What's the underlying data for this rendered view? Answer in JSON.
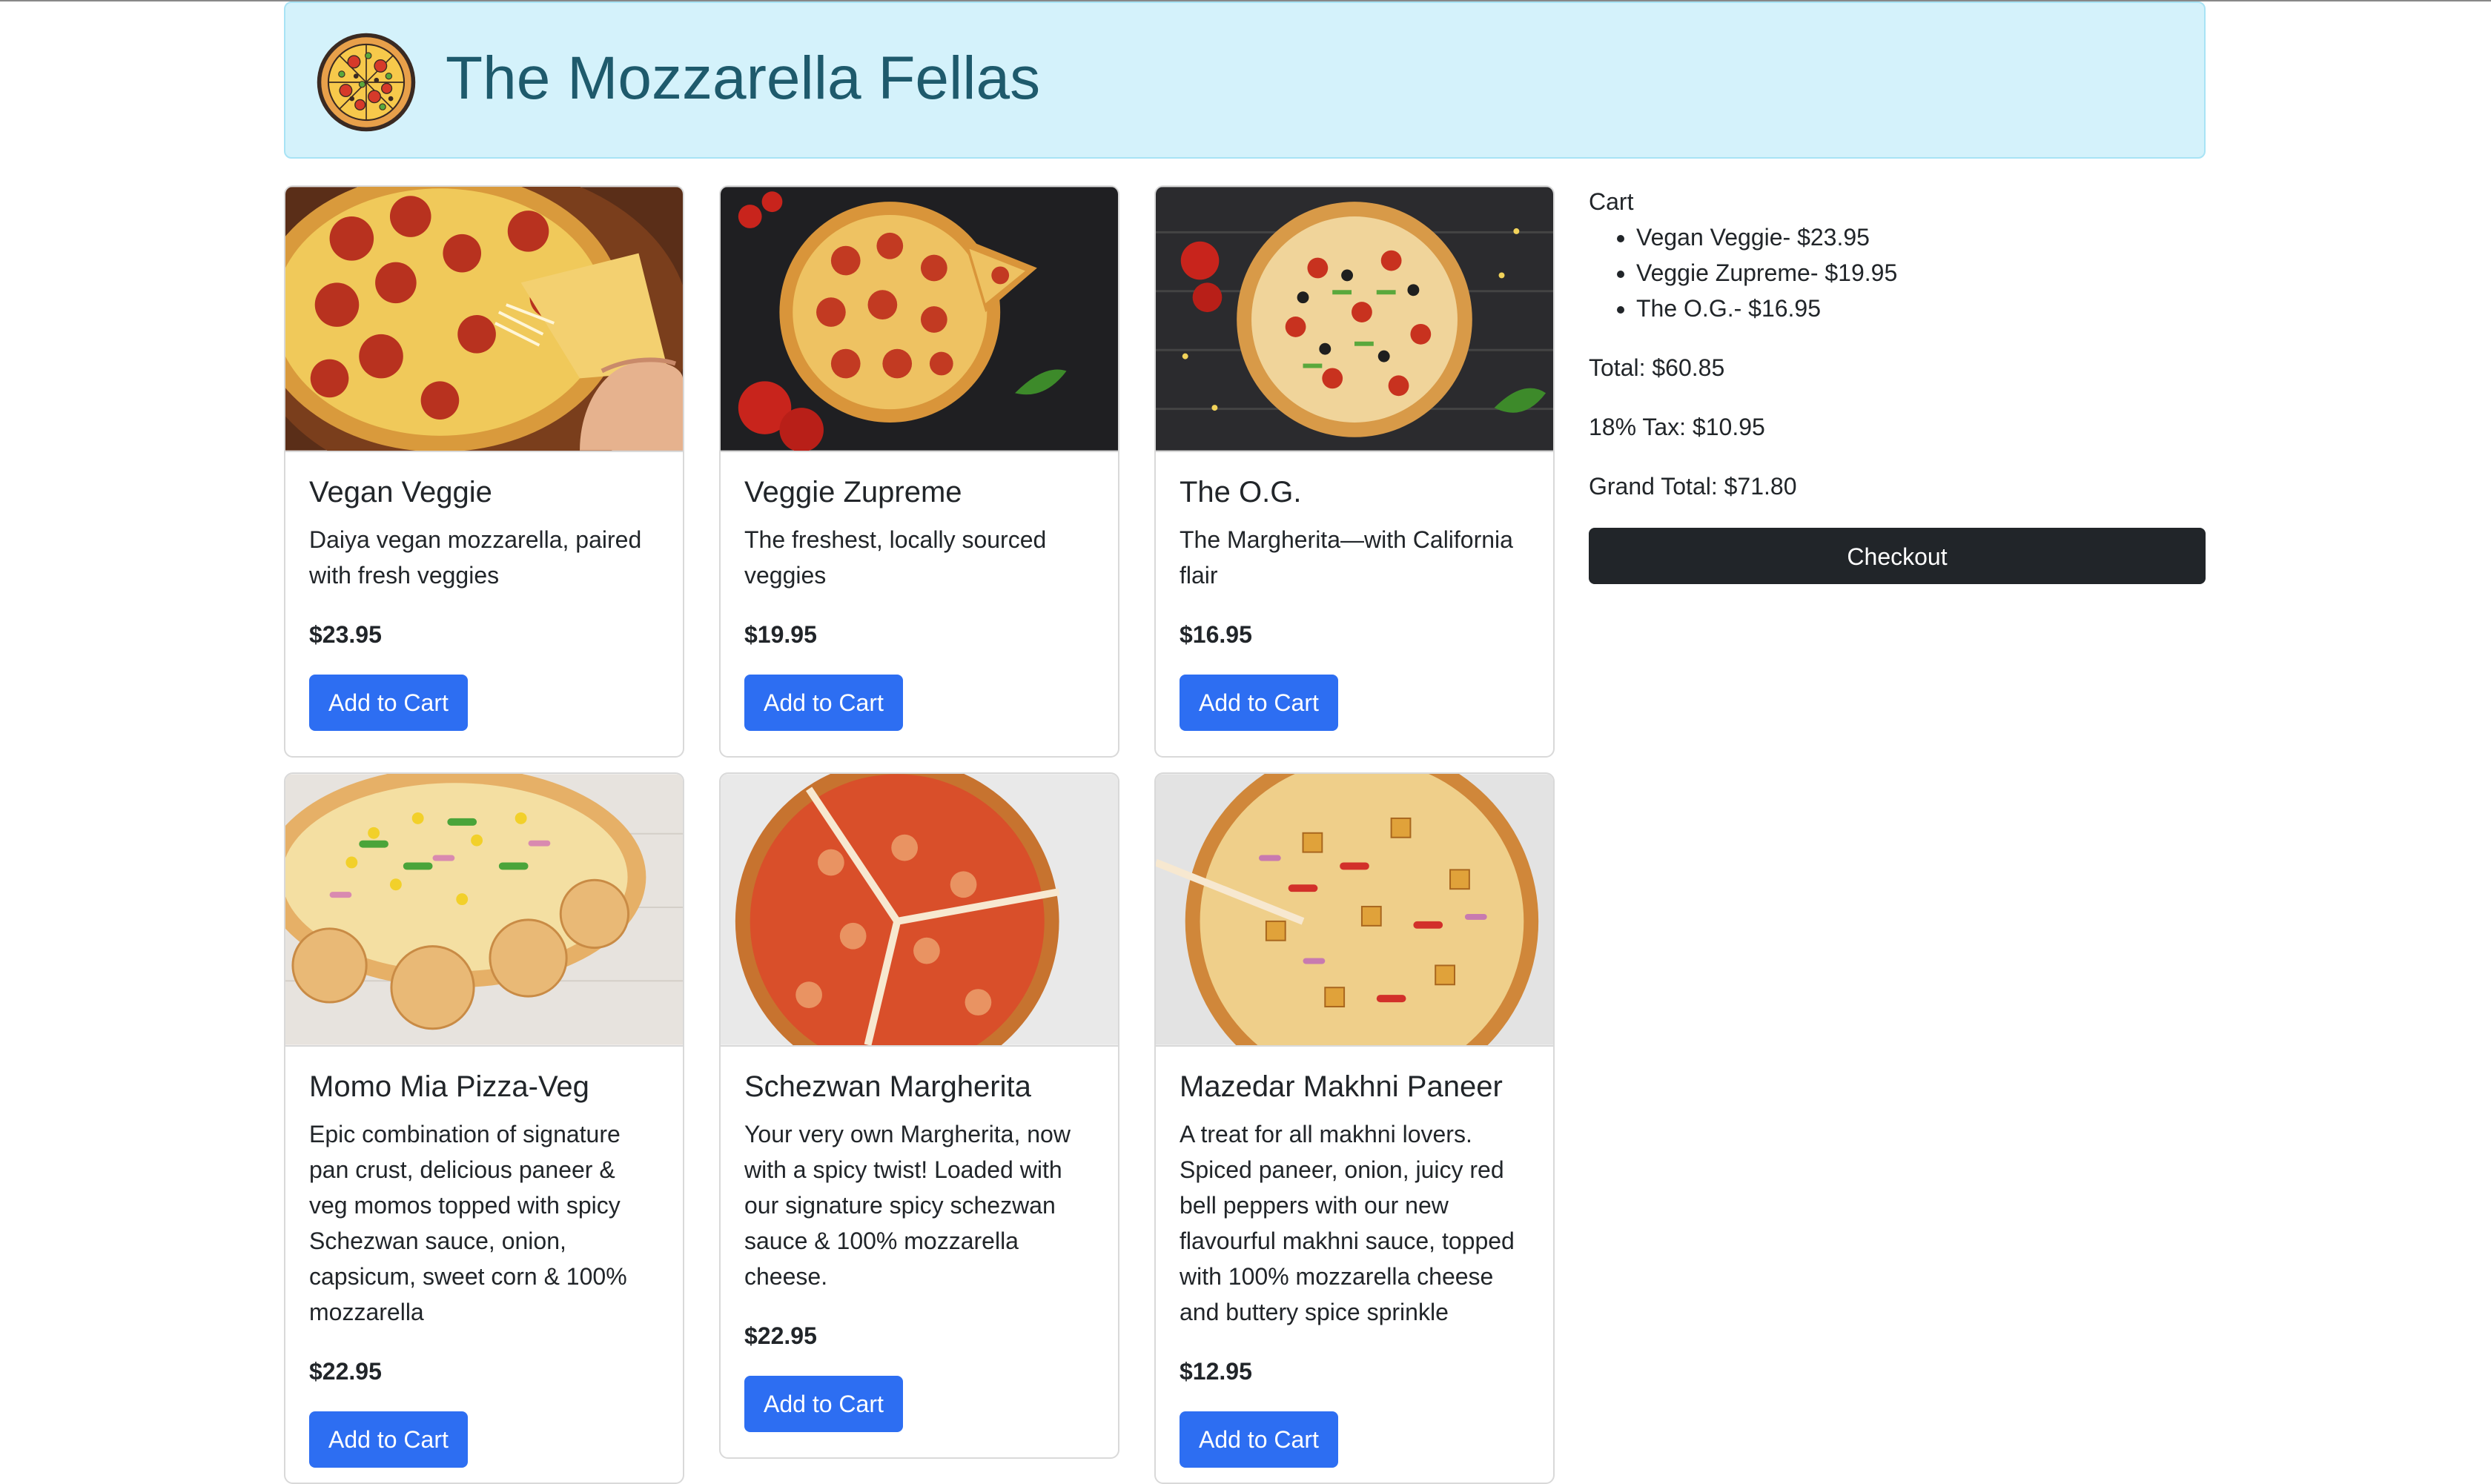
{
  "header": {
    "title": "The Mozzarella Fellas",
    "logo_icon": "pizza-logo-icon"
  },
  "products": [
    {
      "name": "Vegan Veggie",
      "description": "Daiya vegan mozzarella, paired with fresh veggies",
      "price": "$23.95",
      "button": "Add to Cart",
      "image": "pepperoni-slice-photo"
    },
    {
      "name": "Veggie Zupreme",
      "description": "The freshest, locally sourced veggies",
      "price": "$19.95",
      "button": "Add to Cart",
      "image": "pepperoni-dark-photo"
    },
    {
      "name": "The O.G.",
      "description": "The Margherita—with California flair",
      "price": "$16.95",
      "button": "Add to Cart",
      "image": "supreme-pizza-photo"
    },
    {
      "name": "Momo Mia Pizza-Veg",
      "description": "Epic combination of signature pan crust, delicious paneer & veg momos topped with spicy Schezwan sauce, onion, capsicum, sweet corn & 100% mozzarella",
      "price": "$22.95",
      "button": "Add to Cart",
      "image": "momo-pizza-photo"
    },
    {
      "name": "Schezwan Margherita",
      "description": "Your very own Margherita, now with a spicy twist! Loaded with our signature spicy schezwan sauce & 100% mozzarella cheese.",
      "price": "$22.95",
      "button": "Add to Cart",
      "image": "schezwan-pizza-photo"
    },
    {
      "name": "Mazedar Makhni Paneer",
      "description": "A treat for all makhni lovers. Spiced paneer, onion, juicy red bell peppers with our new flavourful makhni sauce, topped with 100% mozzarella cheese and buttery spice sprinkle",
      "price": "$12.95",
      "button": "Add to Cart",
      "image": "paneer-pizza-photo"
    }
  ],
  "cart": {
    "title": "Cart",
    "items": [
      "Vegan Veggie- $23.95",
      "Veggie Zupreme- $19.95",
      "The O.G.- $16.95"
    ],
    "total": "Total: $60.85",
    "tax": "18% Tax: $10.95",
    "grand_total": "Grand Total: $71.80",
    "checkout": "Checkout"
  },
  "colors": {
    "header_bg": "#d4f2fb",
    "title_color": "#1e5a6c",
    "primary_button": "#2d6ef2",
    "checkout_button": "#212529"
  }
}
